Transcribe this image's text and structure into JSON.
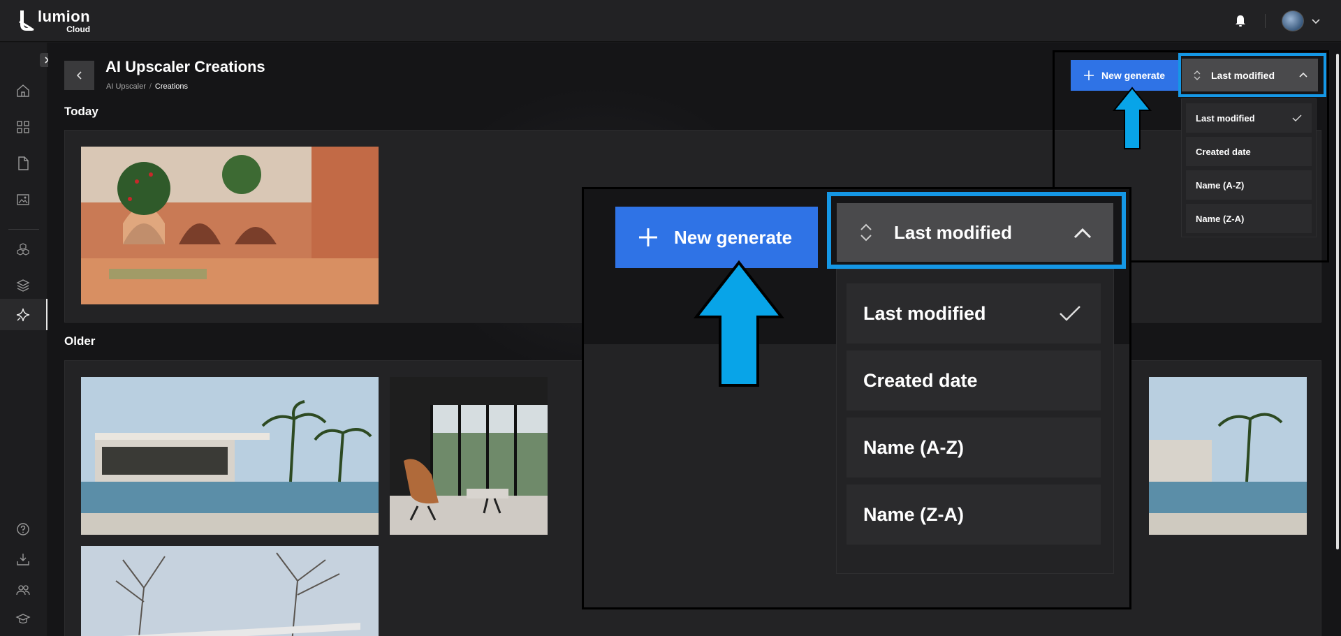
{
  "brand": {
    "name": "lumion",
    "sub": "Cloud"
  },
  "header": {
    "icons": [
      "bell-icon",
      "avatar",
      "chevron-down-icon"
    ]
  },
  "sidebar": {
    "icons": [
      "home-icon",
      "grid-icon",
      "file-icon",
      "image-folder-icon",
      "cubes-icon",
      "layers-icon",
      "sparkle-icon",
      "help-icon",
      "download-icon",
      "users-icon",
      "graduation-cap-icon"
    ],
    "active": "sparkle-icon"
  },
  "page": {
    "title": "AI Upscaler Creations",
    "breadcrumb": [
      "AI Upscaler",
      "Creations"
    ]
  },
  "sections": [
    {
      "heading": "Today"
    },
    {
      "heading": "Older"
    }
  ],
  "toolbar": {
    "new_label": "New generate",
    "sort_label": "Last modified"
  },
  "sort_options": [
    {
      "label": "Last modified",
      "selected": true
    },
    {
      "label": "Created date",
      "selected": false
    },
    {
      "label": "Name (A-Z)",
      "selected": false
    },
    {
      "label": "Name (Z-A)",
      "selected": false
    }
  ],
  "colors": {
    "accent": "#2f73e6",
    "highlight": "#1597e5",
    "arrow": "#08a4e8",
    "background": "#151517"
  }
}
